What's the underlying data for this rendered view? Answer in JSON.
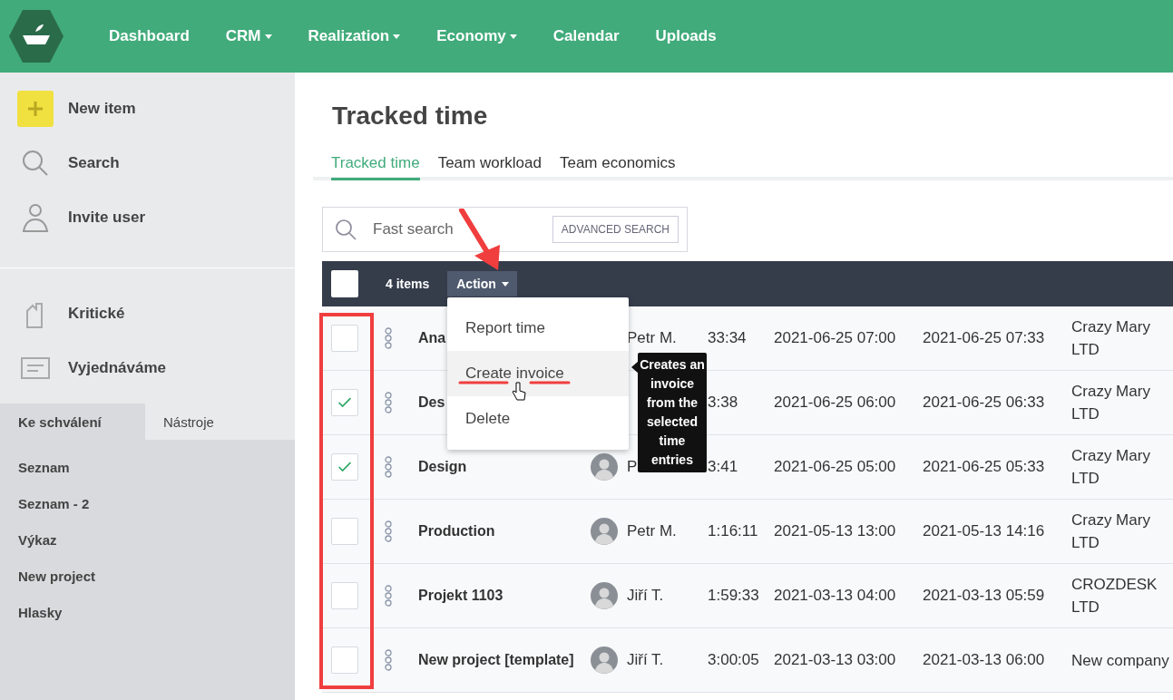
{
  "nav": {
    "items": [
      {
        "label": "Dashboard",
        "dropdown": false
      },
      {
        "label": "CRM",
        "dropdown": true
      },
      {
        "label": "Realization",
        "dropdown": true
      },
      {
        "label": "Economy",
        "dropdown": true
      },
      {
        "label": "Calendar",
        "dropdown": false
      },
      {
        "label": "Uploads",
        "dropdown": false
      }
    ]
  },
  "sidebar": {
    "actions": [
      {
        "label": "New item",
        "kind": "add"
      },
      {
        "label": "Search",
        "kind": "search"
      },
      {
        "label": "Invite user",
        "kind": "user"
      }
    ],
    "favorites": [
      {
        "label": "Kritické",
        "kind": "hand"
      },
      {
        "label": "Vyjednáváme",
        "kind": "chat"
      }
    ],
    "tabs": [
      {
        "label": "Ke schválení",
        "selected": true
      },
      {
        "label": "Nástroje",
        "selected": false
      }
    ],
    "list": [
      "Seznam",
      "Seznam - 2",
      "Výkaz",
      "New project",
      "Hlasky"
    ]
  },
  "page": {
    "title": "Tracked time",
    "tabs": [
      {
        "label": "Tracked time",
        "selected": true
      },
      {
        "label": "Team workload",
        "selected": false
      },
      {
        "label": "Team economics",
        "selected": false
      }
    ]
  },
  "search": {
    "placeholder": "Fast search",
    "advanced": "ADVANCED SEARCH"
  },
  "table": {
    "header": {
      "checked": false,
      "count": "4 items",
      "action": "Action"
    },
    "rows": [
      {
        "checked": false,
        "name": "Ana",
        "avatar": false,
        "person": "Petr M.",
        "duration": "33:34",
        "start": "2021-06-25 07:00",
        "end": "2021-06-25 07:33",
        "company": "Crazy Mary LTD"
      },
      {
        "checked": true,
        "name": "Des",
        "avatar": false,
        "person": "",
        "duration": "3:38",
        "start": "2021-06-25 06:00",
        "end": "2021-06-25 06:33",
        "company": "Crazy Mary LTD"
      },
      {
        "checked": true,
        "name": "Design",
        "avatar": true,
        "person": "P",
        "duration": "3:41",
        "start": "2021-06-25 05:00",
        "end": "2021-06-25 05:33",
        "company": "Crazy Mary LTD"
      },
      {
        "checked": false,
        "name": "Production",
        "avatar": true,
        "person": "Petr M.",
        "duration": "1:16:11",
        "start": "2021-05-13 13:00",
        "end": "2021-05-13 14:16",
        "company": "Crazy Mary LTD"
      },
      {
        "checked": false,
        "name": "Projekt 1103",
        "avatar": true,
        "person": "Jiří T.",
        "duration": "1:59:33",
        "start": "2021-03-13 04:00",
        "end": "2021-03-13 05:59",
        "company": "CROZDESK LTD"
      },
      {
        "checked": false,
        "name": "New project [template]",
        "avatar": true,
        "person": "Jiří T.",
        "duration": "3:00:05",
        "start": "2021-03-13 03:00",
        "end": "2021-03-13 06:00",
        "company": "New company"
      }
    ]
  },
  "action_menu": {
    "items": [
      {
        "label": "Report time",
        "selected": false
      },
      {
        "label": "Create invoice",
        "selected": true
      },
      {
        "label": "Delete",
        "selected": false
      }
    ],
    "tooltip": "Creates an invoice from the selected time entries"
  }
}
